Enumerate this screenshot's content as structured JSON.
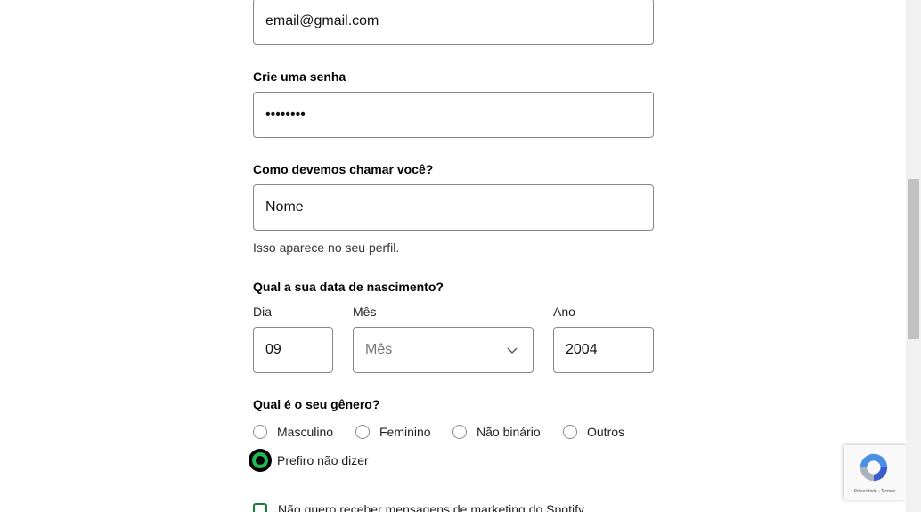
{
  "email": {
    "value": "email@gmail.com"
  },
  "password": {
    "label": "Crie uma senha",
    "value": "••••••••"
  },
  "name": {
    "label": "Como devemos chamar você?",
    "value": "Nome",
    "hint": "Isso aparece no seu perfil."
  },
  "birthdate": {
    "label": "Qual a sua data de nascimento?",
    "day": {
      "label": "Dia",
      "value": "09"
    },
    "month": {
      "label": "Mês",
      "placeholder": "Mês"
    },
    "year": {
      "label": "Ano",
      "value": "2004"
    }
  },
  "gender": {
    "label": "Qual é o seu gênero?",
    "options": [
      "Masculino",
      "Feminino",
      "Não binário",
      "Outros",
      "Prefiro não dizer"
    ],
    "selected": "Prefiro não dizer"
  },
  "marketing": {
    "label": "Não quero receber mensagens de marketing do Spotify"
  },
  "recaptcha": {
    "links": "Privacidade - Termos"
  },
  "colors": {
    "accent": "#1db954",
    "checkbox": "#1b7f3b",
    "border": "#878787"
  }
}
